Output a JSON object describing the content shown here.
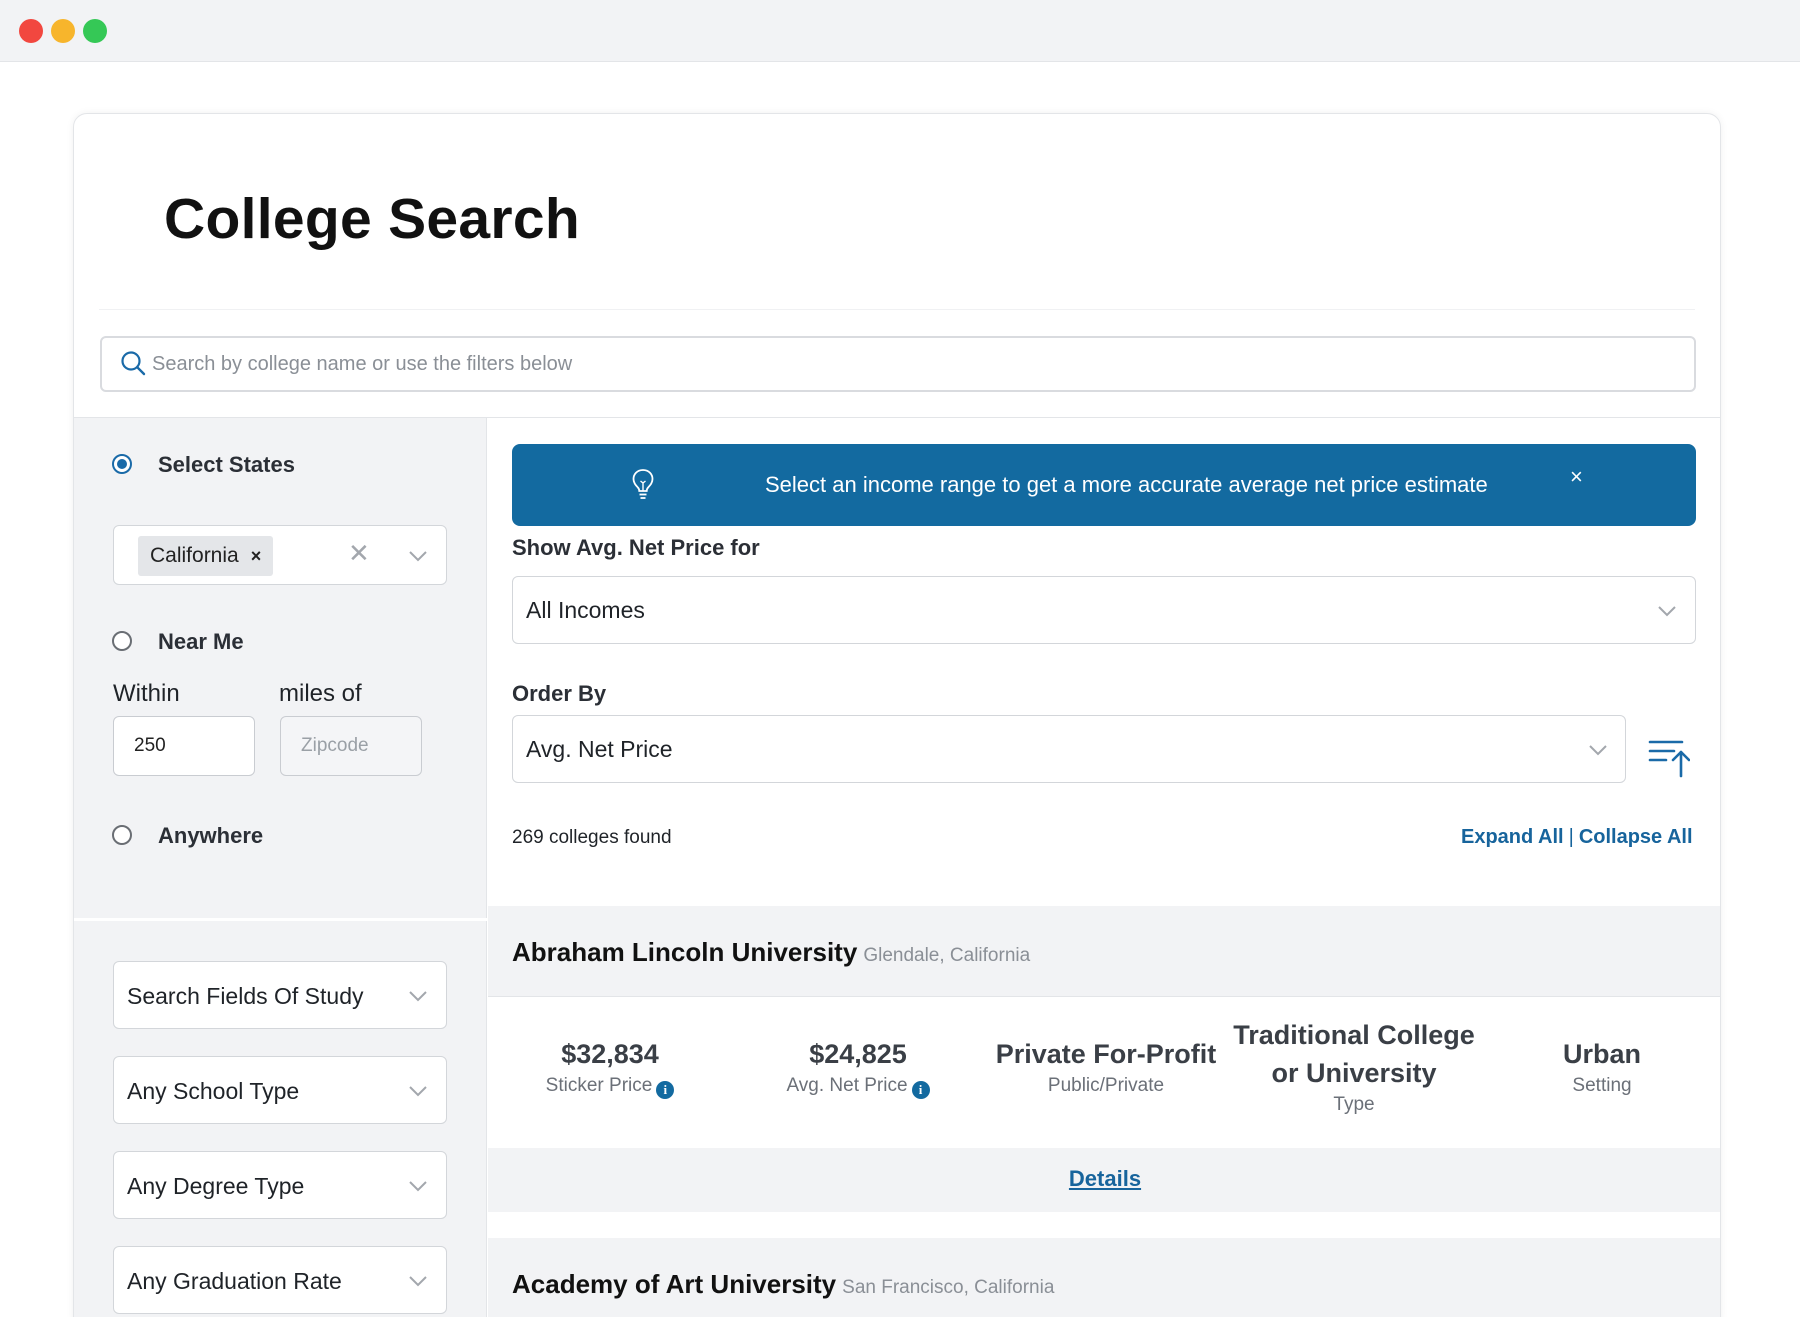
{
  "page": {
    "title": "College Search"
  },
  "search": {
    "placeholder": "Search by college name or use the filters below"
  },
  "sidebar": {
    "location_options": [
      {
        "label": "Select States",
        "checked": true
      },
      {
        "label": "Near Me",
        "checked": false
      },
      {
        "label": "Anywhere",
        "checked": false
      }
    ],
    "selected_state_chip": "California",
    "chip_remove": "×",
    "clear_all": "✕",
    "within_label": "Within",
    "miles_label": "miles of",
    "miles_value": "250",
    "zipcode_placeholder": "Zipcode",
    "filters": [
      {
        "label": "Search Fields Of Study"
      },
      {
        "label": "Any School Type"
      },
      {
        "label": "Any Degree Type"
      },
      {
        "label": "Any Graduation Rate"
      }
    ]
  },
  "banner": {
    "text": "Select an income range to get a more accurate average net price estimate",
    "close": "×"
  },
  "net_price": {
    "label": "Show Avg. Net Price for",
    "value": "All Incomes"
  },
  "order_by": {
    "label": "Order By",
    "value": "Avg. Net Price"
  },
  "results_summary": {
    "found": "269 colleges found",
    "expand_all": "Expand All",
    "separator": "|",
    "collapse_all": "Collapse All"
  },
  "results": [
    {
      "name": "Abraham Lincoln University",
      "location": "Glendale, California",
      "stats": [
        {
          "value": "$32,834",
          "caption": "Sticker Price",
          "info": true
        },
        {
          "value": "$24,825",
          "caption": "Avg. Net Price",
          "info": true
        },
        {
          "value": "Private For-Profit",
          "caption": "Public/Private",
          "info": false
        },
        {
          "value": "Traditional College or University",
          "caption": "Type",
          "info": false
        },
        {
          "value": "Urban",
          "caption": "Setting",
          "info": false
        }
      ],
      "details_label": "Details"
    },
    {
      "name": "Academy of Art University",
      "location": "San Francisco, California"
    }
  ],
  "colors": {
    "accent": "#136aa0",
    "link": "#17649c",
    "panel_bg": "#f2f3f5"
  },
  "icons": {
    "search": "search-icon",
    "lightbulb": "lightbulb-icon",
    "sort": "sort-ascending-icon",
    "chevron": "chevron-down-icon",
    "info": "info-icon"
  },
  "window_controls": [
    "close",
    "minimize",
    "zoom"
  ]
}
